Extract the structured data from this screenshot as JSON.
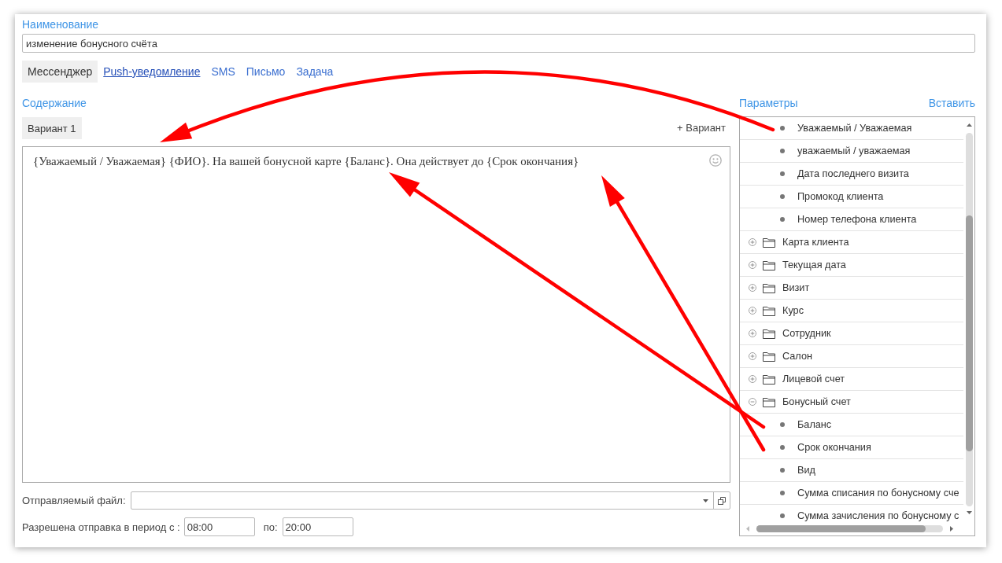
{
  "name_field": {
    "label": "Наименование",
    "value": "изменение бонусного счёта"
  },
  "channel_tabs": [
    {
      "label": "Мессенджер",
      "selected": true,
      "hovered": false
    },
    {
      "label": "Push-уведомление",
      "selected": false,
      "hovered": true
    },
    {
      "label": "SMS",
      "selected": false,
      "hovered": false
    },
    {
      "label": "Письмо",
      "selected": false,
      "hovered": false
    },
    {
      "label": "Задача",
      "selected": false,
      "hovered": false
    }
  ],
  "content": {
    "label": "Содержание",
    "variants": [
      {
        "label": "Вариант 1",
        "selected": true
      }
    ],
    "add_variant": "+ Вариант",
    "text": "{Уважаемый / Уважаемая} {ФИО}. На вашей бонусной карте {Баланс}. Она действует до {Срок окончания}"
  },
  "attachment": {
    "label": "Отправляемый файл:"
  },
  "send_period": {
    "label": "Разрешена отправка в период с :",
    "from": "08:00",
    "to_label": "по:",
    "to": "20:00"
  },
  "parameters": {
    "label": "Параметры",
    "insert": "Вставить",
    "items": [
      {
        "kind": "field",
        "label": "Уважаемый / Уважаемая",
        "selected": false
      },
      {
        "kind": "field",
        "label": "уважаемый / уважаемая",
        "selected": false
      },
      {
        "kind": "field",
        "label": "Дата последнего визита",
        "selected": false
      },
      {
        "kind": "field",
        "label": "Промокод клиента",
        "selected": false
      },
      {
        "kind": "field",
        "label": "Номер телефона клиента",
        "selected": false
      },
      {
        "kind": "group",
        "label": "Карта клиента",
        "expanded": false,
        "selected": false
      },
      {
        "kind": "group",
        "label": "Текущая дата",
        "expanded": false,
        "selected": false
      },
      {
        "kind": "group",
        "label": "Визит",
        "expanded": false,
        "selected": false
      },
      {
        "kind": "group",
        "label": "Курс",
        "expanded": false,
        "selected": false
      },
      {
        "kind": "group",
        "label": "Сотрудник",
        "expanded": false,
        "selected": false
      },
      {
        "kind": "group",
        "label": "Салон",
        "expanded": false,
        "selected": false
      },
      {
        "kind": "group",
        "label": "Лицевой счет",
        "expanded": false,
        "selected": false
      },
      {
        "kind": "group",
        "label": "Бонусный счет",
        "expanded": true,
        "selected": false,
        "children": [
          {
            "kind": "field",
            "label": "Баланс",
            "selected": false
          },
          {
            "kind": "field",
            "label": "Срок окончания",
            "selected": false
          },
          {
            "kind": "field",
            "label": "Вид",
            "selected": false
          },
          {
            "kind": "field",
            "label": "Сумма списания по бонусному сче",
            "selected": false
          },
          {
            "kind": "field",
            "label": "Сумма зачисления по бонусному с",
            "selected": false
          }
        ]
      }
    ]
  }
}
